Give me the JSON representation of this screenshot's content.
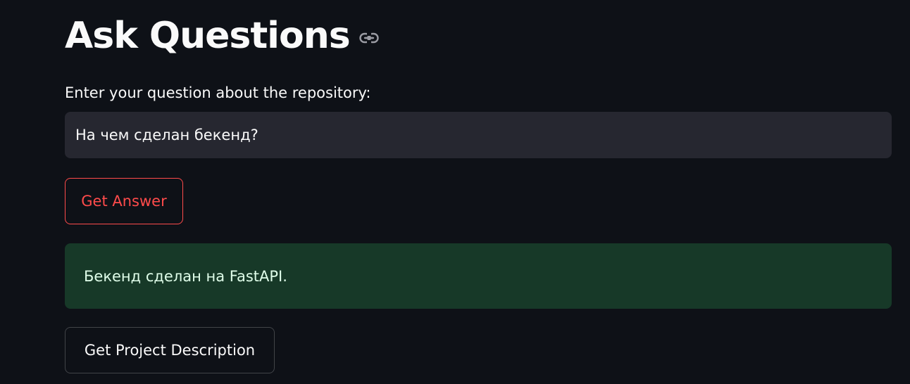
{
  "header": {
    "title": "Ask Questions",
    "anchor_icon": "link-icon"
  },
  "question": {
    "label": "Enter your question about the repository:",
    "value": "На чем сделан бекенд?"
  },
  "actions": {
    "get_answer_label": "Get Answer",
    "get_description_label": "Get Project Description"
  },
  "answer": {
    "text": "Бекенд сделан на FastAPI."
  },
  "colors": {
    "background": "#0e1117",
    "input_background": "#262730",
    "primary_accent": "#ff4b4b",
    "success_background": "#173928",
    "success_text": "#dffde9"
  }
}
